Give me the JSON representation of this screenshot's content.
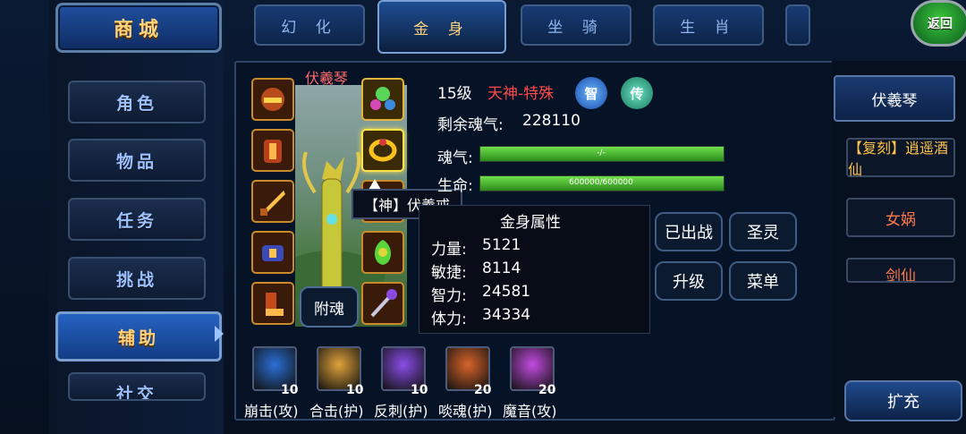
{
  "left_menu": {
    "shop": "商城",
    "items": [
      "角色",
      "物品",
      "任务",
      "挑战",
      "辅助",
      "社交"
    ],
    "active_index": 4
  },
  "top_tabs": [
    "幻 化",
    "金 身",
    "坐 骑",
    "生 肖"
  ],
  "top_active_index": 1,
  "back_label": "返回",
  "portrait_title": "伏羲琴",
  "tooltip": "【神】伏羲戒",
  "fuhun": "附魂",
  "info": {
    "level": "15级",
    "god_type": "天神-特殊",
    "badge1": "智",
    "badge2": "传",
    "remain_label": "剩余魂气:",
    "remain_value": "228110",
    "hunqi_label": "魂气:",
    "hunqi_bar_text": "-/-",
    "hp_label": "生命:",
    "hp_bar_text": "600000/600000",
    "hp_fraction": 1.0,
    "hunqi_fraction": 1.0
  },
  "stats": {
    "title": "金身属性",
    "rows": [
      {
        "label": "力量:",
        "value": "5121"
      },
      {
        "label": "敏捷:",
        "value": "8114"
      },
      {
        "label": "智力:",
        "value": "24581"
      },
      {
        "label": "体力:",
        "value": "34334"
      }
    ]
  },
  "actions": {
    "deployed": "已出战",
    "holy": "圣灵",
    "upgrade": "升级",
    "menu": "菜单"
  },
  "skills": [
    {
      "count": "10",
      "label": "崩击(攻)",
      "color": "#2a6fd6"
    },
    {
      "count": "10",
      "label": "合击(护)",
      "color": "#e0a23a"
    },
    {
      "count": "10",
      "label": "反刺(护)",
      "color": "#8a4de8"
    },
    {
      "count": "20",
      "label": "啖魂(护)",
      "color": "#d8642a"
    },
    {
      "count": "20",
      "label": "魔音(攻)",
      "color": "#c24be0"
    }
  ],
  "right_list": {
    "selected": "伏羲琴",
    "items": [
      "【复刻】逍遥酒仙",
      "女娲",
      "剑仙"
    ]
  },
  "expand": "扩充"
}
